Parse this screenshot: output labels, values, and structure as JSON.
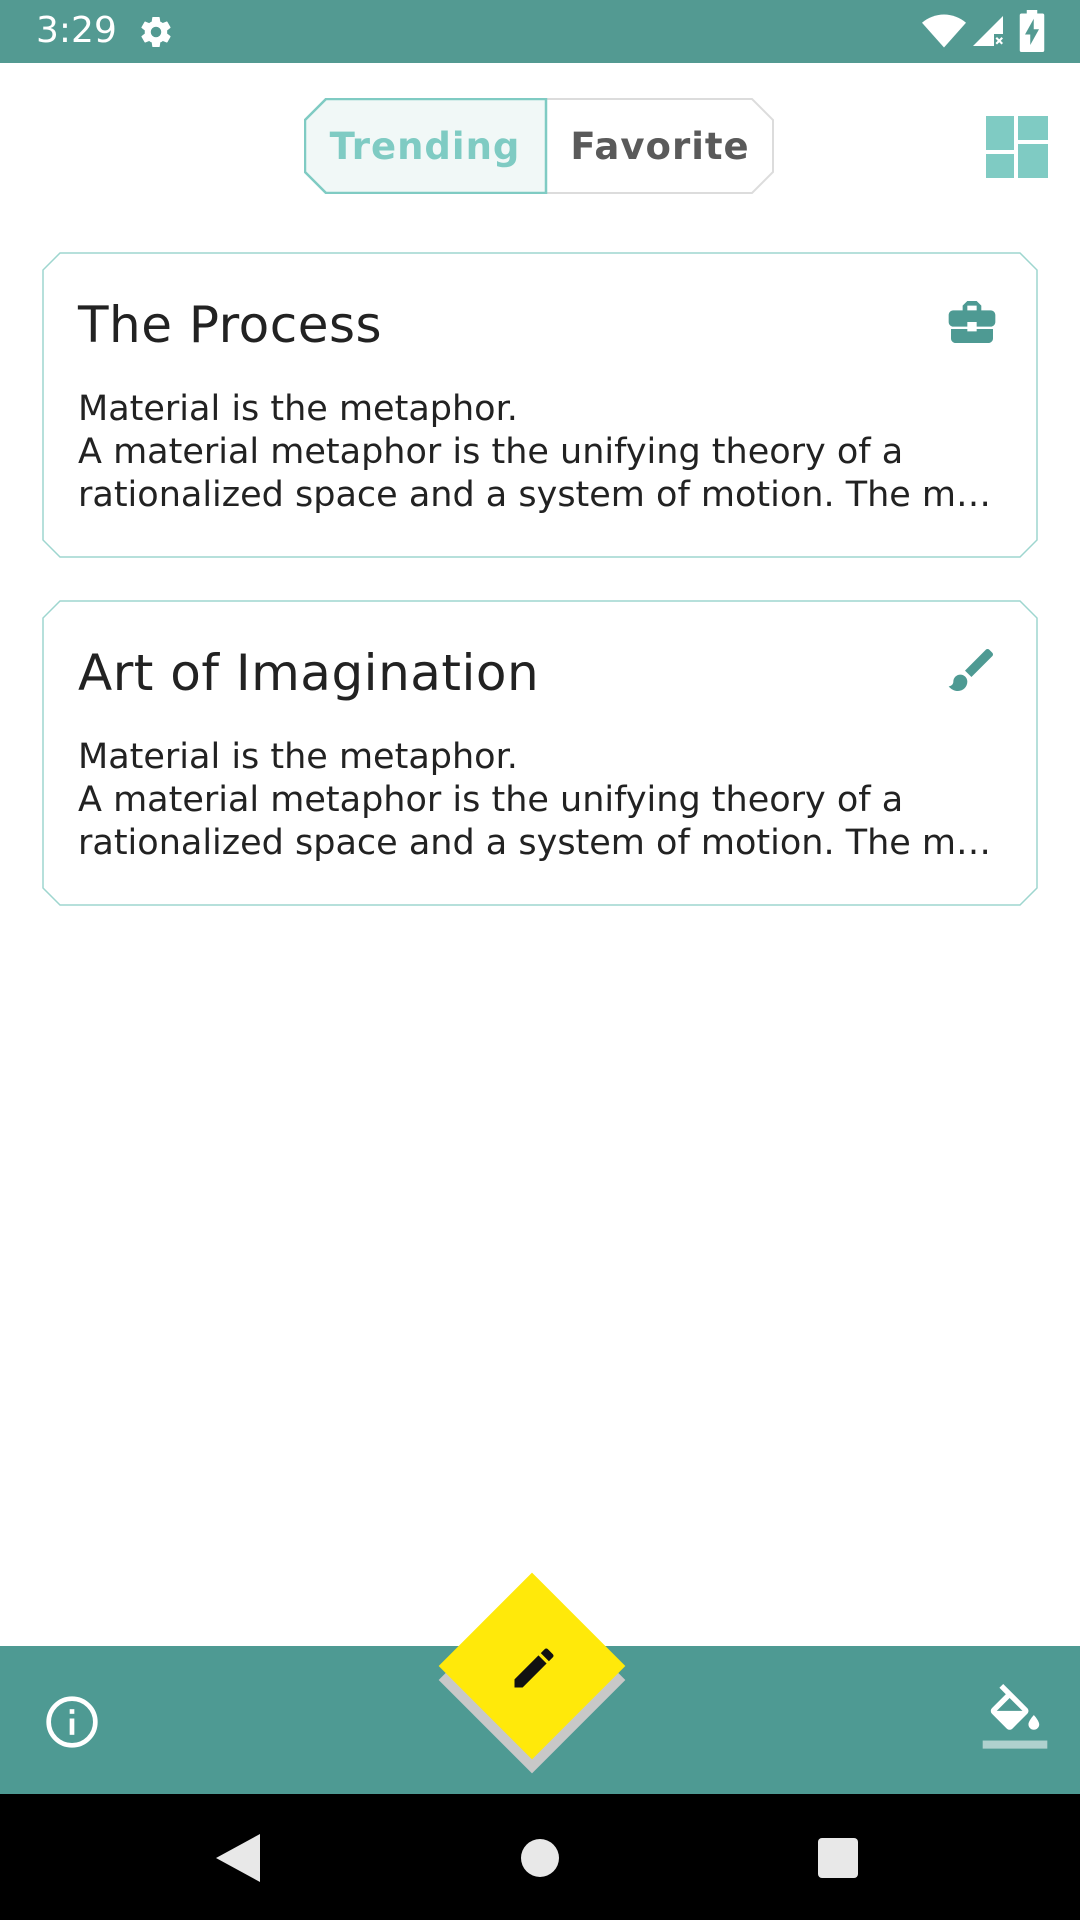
{
  "status_bar": {
    "time": "3:29",
    "icons": [
      "settings-icon",
      "wifi-icon",
      "signal-icon",
      "battery-icon"
    ]
  },
  "toggle": {
    "options": [
      {
        "label": "Trending",
        "selected": true
      },
      {
        "label": "Favorite",
        "selected": false
      }
    ]
  },
  "header": {
    "layout_icon": "dashboard-icon"
  },
  "cards": [
    {
      "title": "The Process",
      "body": "Material is the metaphor.\n A material metaphor is the unifying theory of a rationalized space and a system of motion. The m…",
      "icon": "briefcase-icon"
    },
    {
      "title": "Art of Imagination",
      "body": "Material is the metaphor.\n A material metaphor is the unifying theory of a rationalized space and a system of motion. The m…",
      "icon": "brush-icon"
    }
  ],
  "bottom_bar": {
    "left_icon": "info-icon",
    "fab_icon": "pencil-icon",
    "right_icon": "format-color-fill-icon"
  },
  "colors": {
    "primary": "#539A92",
    "accent": "#FFE90A",
    "toggle_selected_text": "#7FCBC3"
  }
}
